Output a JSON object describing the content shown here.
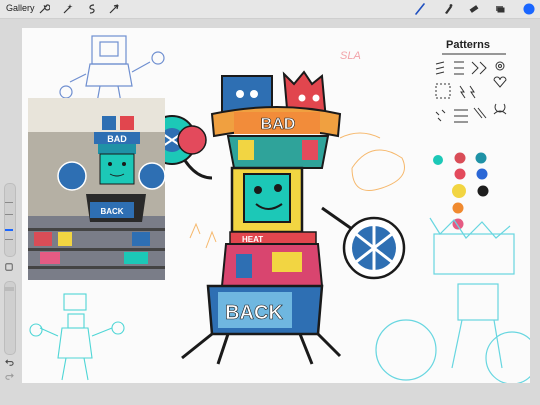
{
  "app": {
    "gallery_label": "Gallery"
  },
  "canvas": {
    "patterns_title": "Patterns",
    "sketch_signature": "SLA",
    "robot_labels": {
      "bad": "BAD",
      "back": "BACK",
      "heat": "HEAT"
    }
  },
  "reference": {
    "bad": "BAD",
    "back": "BACK"
  },
  "colors": {
    "accent": "#1a66ff",
    "brush_active": "#1f4fbf",
    "swatches": [
      "#1cc8b7",
      "#d94d57",
      "#1f92a6",
      "#e34a5c",
      "#2b67d6",
      "#f2d542",
      "#1d1d1d",
      "#f08a2f",
      "#e55b83"
    ]
  },
  "icons": [
    "wrench-icon",
    "magic-wand-icon",
    "selection-icon",
    "transform-icon",
    "brush-icon",
    "smudge-icon",
    "eraser-icon",
    "layers-icon",
    "color-icon",
    "undo-icon",
    "redo-icon",
    "modify-icon"
  ]
}
